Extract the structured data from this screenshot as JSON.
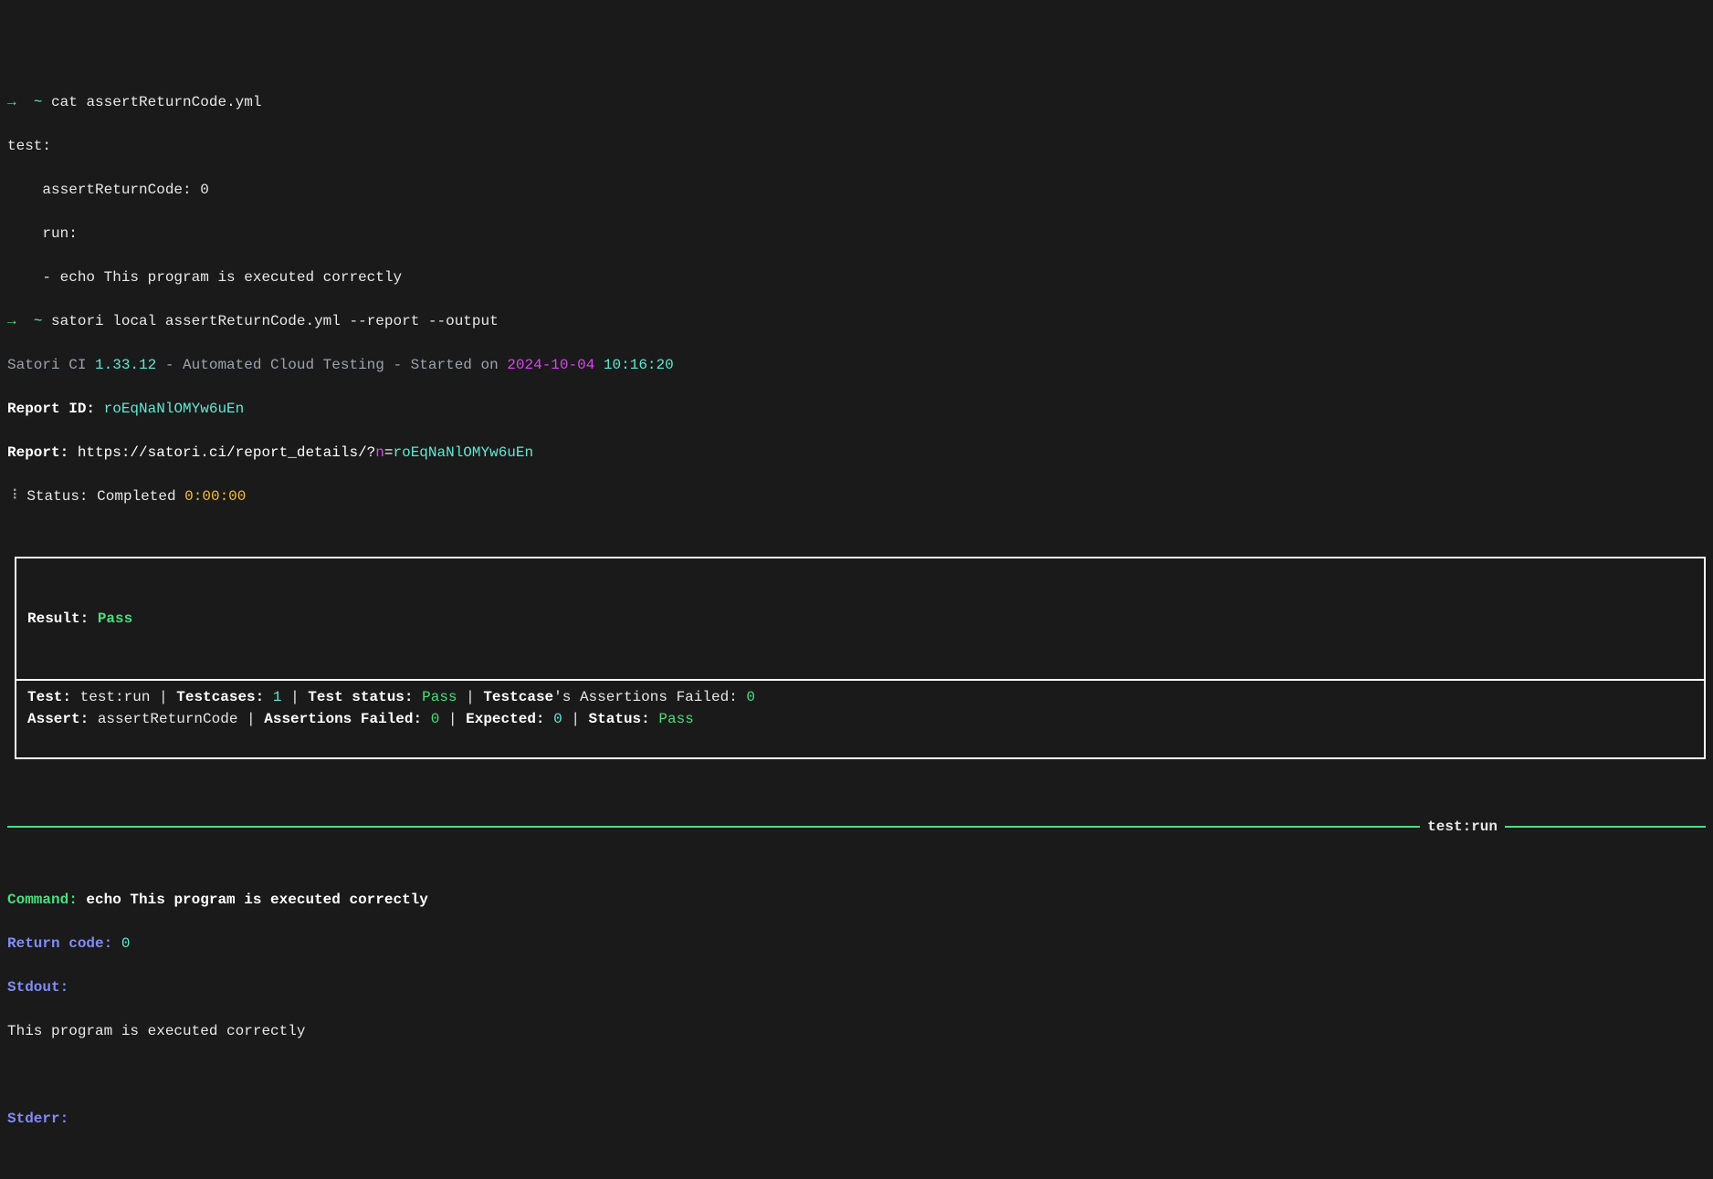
{
  "prompt1": {
    "arrow": "→",
    "tilde": "~",
    "cmd": "cat assertReturnCode.yml"
  },
  "yml": {
    "l1": "test:",
    "l2": "    assertReturnCode: 0",
    "l3": "    run:",
    "l4": "    - echo This program is executed correctly"
  },
  "prompt2": {
    "arrow": "→",
    "tilde": "~",
    "cmd": "satori local assertReturnCode.yml --report --output"
  },
  "header": {
    "satori": "Satori CI ",
    "version": "1.33.12",
    "middle": " - Automated Cloud Testing - Started on ",
    "date": "2024-10-04",
    "time": " 10:16:20"
  },
  "reportid": {
    "label": "Report ID: ",
    "value": "roEqNaNlOMYw6uEn"
  },
  "report": {
    "label": "Report: ",
    "url1": "https://satori.ci/report_details/?",
    "url2": "n",
    "url3": "=",
    "url4": "roEqNaNlOMYw6uEn"
  },
  "status": {
    "spinner": "⠸",
    "label": " Status: Completed ",
    "time": "0:00:00"
  },
  "result": {
    "label": "Result: ",
    "value": "Pass"
  },
  "testline": {
    "p1": "Test: ",
    "p2": "test:run",
    "p3": " | ",
    "p4": "Testcases: ",
    "p5": "1",
    "p6": " | ",
    "p7": "Test status: ",
    "p8": "Pass",
    "p9": " | ",
    "p10": "Testcase",
    "p11": "'s Assertions Failed: ",
    "p12": "0"
  },
  "assertline": {
    "p1": "Assert: ",
    "p2": "assertReturnCode",
    "p3": " | ",
    "p4": "Assertions Failed: ",
    "p5": "0",
    "p6": " | ",
    "p7": "Expected: ",
    "p8": "0",
    "p9": " | ",
    "p10": "Status: ",
    "p11": "Pass"
  },
  "divider": {
    "p1": "test:",
    "p2": "run"
  },
  "command": {
    "label": "Command: ",
    "value": "echo This program is executed correctly"
  },
  "returncode": {
    "label": "Return code: ",
    "value": "0"
  },
  "stdout": {
    "label": "Stdout:",
    "value": "This program is executed correctly"
  },
  "stderr": {
    "label": "Stderr:"
  }
}
